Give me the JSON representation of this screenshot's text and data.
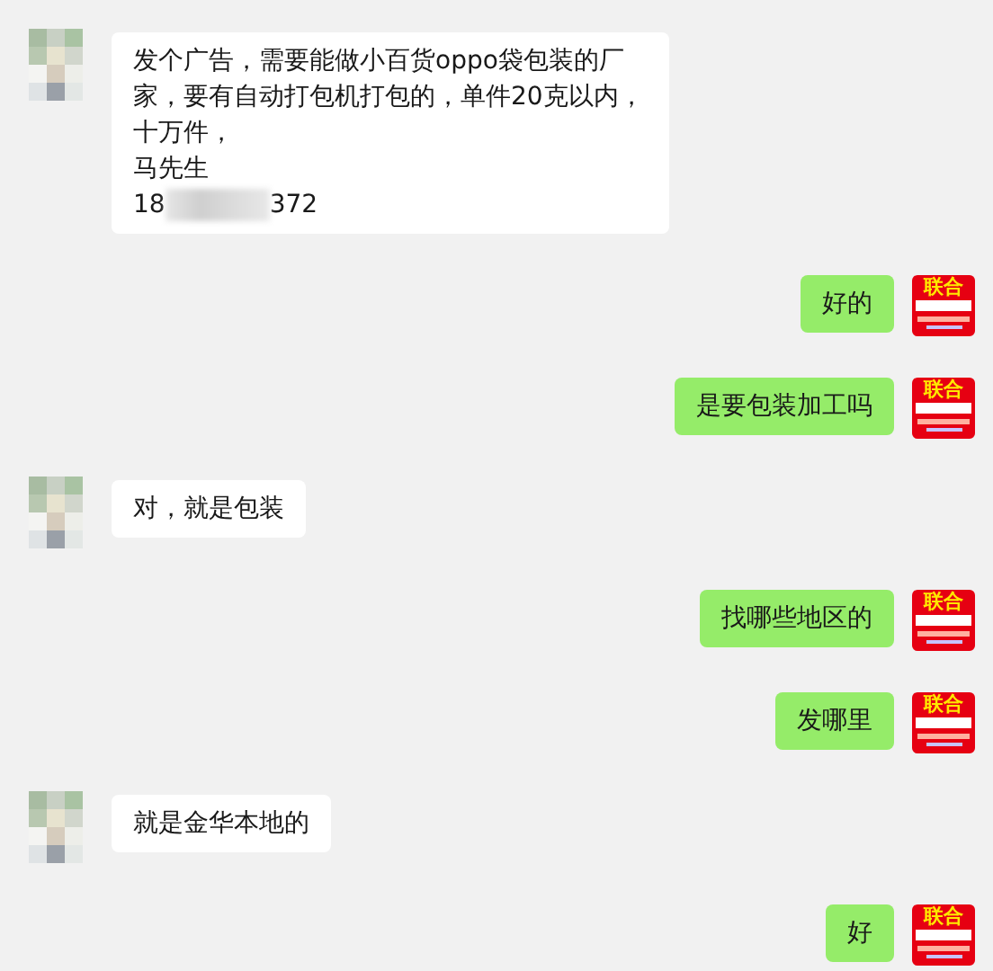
{
  "messages": [
    {
      "kind": "incoming",
      "lines": [
        {
          "kind": "text",
          "text": "发个广告，需要能做小百货oppo袋包装的厂家，要有自动打包机打包的，单件20克以内，十万件，"
        },
        {
          "kind": "text",
          "text": "马先生"
        },
        {
          "kind": "redacted",
          "start": "18",
          "end": "372"
        }
      ]
    },
    {
      "kind": "outgoing",
      "avatar_text": "联合",
      "lines": [
        {
          "kind": "text",
          "text": "好的"
        }
      ]
    },
    {
      "kind": "outgoing",
      "avatar_text": "联合",
      "lines": [
        {
          "kind": "text",
          "text": "是要包装加工吗"
        }
      ]
    },
    {
      "kind": "incoming",
      "lines": [
        {
          "kind": "text",
          "text": "对，就是包装"
        }
      ]
    },
    {
      "kind": "outgoing",
      "avatar_text": "联合",
      "lines": [
        {
          "kind": "text",
          "text": "找哪些地区的"
        }
      ]
    },
    {
      "kind": "outgoing",
      "avatar_text": "联合",
      "lines": [
        {
          "kind": "text",
          "text": "发哪里"
        }
      ]
    },
    {
      "kind": "incoming",
      "lines": [
        {
          "kind": "text",
          "text": "就是金华本地的"
        }
      ]
    },
    {
      "kind": "outgoing",
      "avatar_text": "联合",
      "lines": [
        {
          "kind": "text",
          "text": "好"
        }
      ]
    }
  ]
}
